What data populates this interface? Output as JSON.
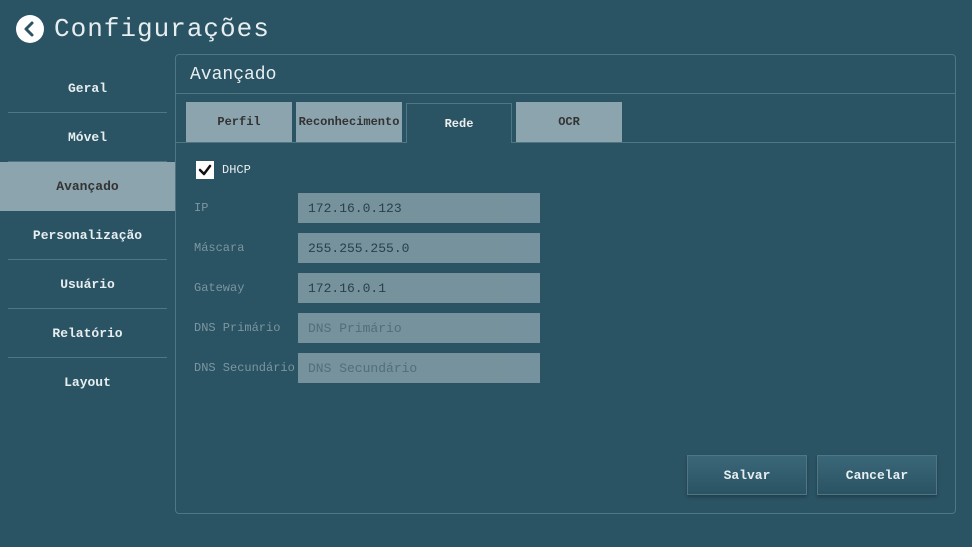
{
  "header": {
    "title": "Configurações"
  },
  "sidebar": {
    "items": [
      {
        "label": "Geral",
        "active": false
      },
      {
        "label": "Móvel",
        "active": false
      },
      {
        "label": "Avançado",
        "active": true
      },
      {
        "label": "Personalização",
        "active": false
      },
      {
        "label": "Usuário",
        "active": false
      },
      {
        "label": "Relatório",
        "active": false
      },
      {
        "label": "Layout",
        "active": false
      }
    ]
  },
  "panel": {
    "title": "Avançado",
    "tabs": [
      {
        "label": "Perfil",
        "active": false
      },
      {
        "label": "Reconhecimento",
        "active": false
      },
      {
        "label": "Rede",
        "active": true
      },
      {
        "label": "OCR",
        "active": false
      }
    ],
    "dhcp": {
      "label": "DHCP",
      "checked": true
    },
    "fields": {
      "ip": {
        "label": "IP",
        "value": "172.16.0.123",
        "placeholder": ""
      },
      "mask": {
        "label": "Máscara",
        "value": "255.255.255.0",
        "placeholder": ""
      },
      "gateway": {
        "label": "Gateway",
        "value": "172.16.0.1",
        "placeholder": ""
      },
      "dns1": {
        "label": "DNS Primário",
        "value": "",
        "placeholder": "DNS Primário"
      },
      "dns2": {
        "label": "DNS Secundário",
        "value": "",
        "placeholder": "DNS Secundário"
      }
    },
    "actions": {
      "save": "Salvar",
      "cancel": "Cancelar"
    }
  }
}
